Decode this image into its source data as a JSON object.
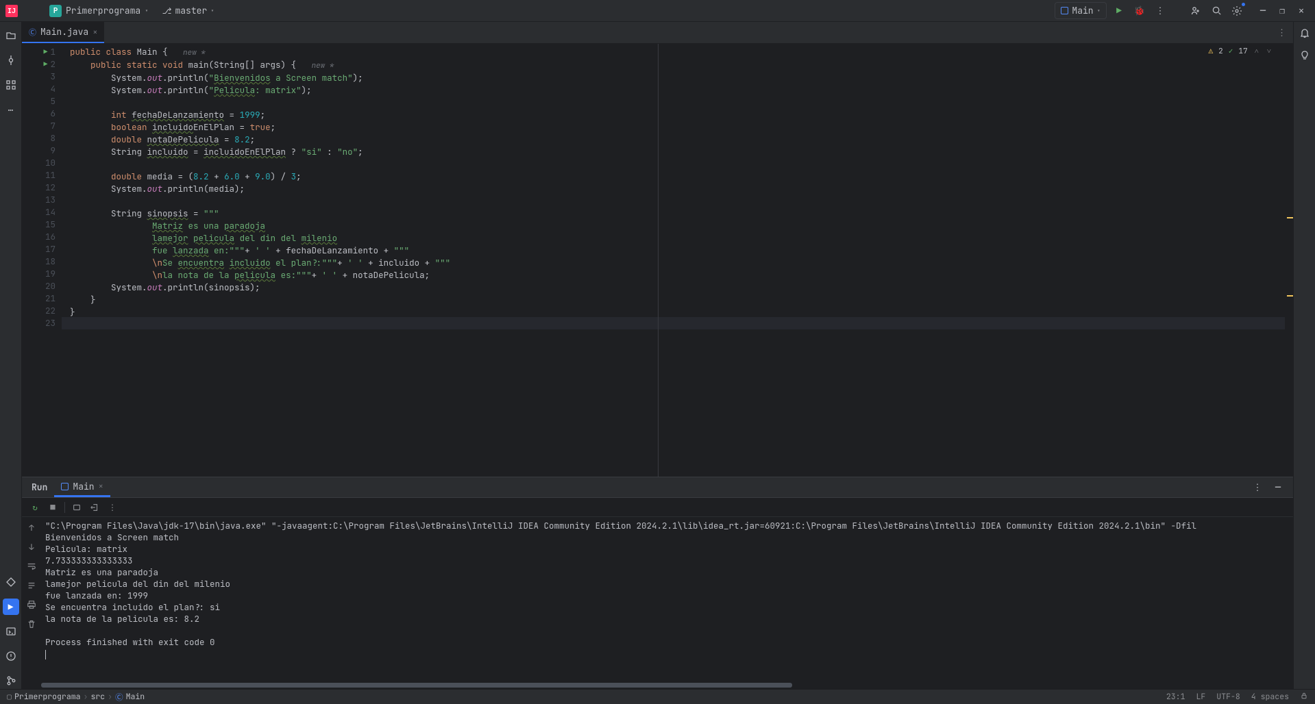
{
  "titlebar": {
    "project_name": "Primerprograma",
    "branch": "master",
    "run_config": "Main"
  },
  "tabs": {
    "file_name": "Main.java"
  },
  "inspections": {
    "warnings": "2",
    "typos": "17"
  },
  "code_lines": [
    {
      "n": 1,
      "run": true,
      "tokens": [
        {
          "t": "public class ",
          "c": "kw"
        },
        {
          "t": "Main {   "
        },
        {
          "t": "new *",
          "c": "hint"
        }
      ]
    },
    {
      "n": 2,
      "run": true,
      "tokens": [
        {
          "t": "    "
        },
        {
          "t": "public static void ",
          "c": "kw"
        },
        {
          "t": "main"
        },
        {
          "t": "(String[] args) {   "
        },
        {
          "t": "new *",
          "c": "hint"
        }
      ]
    },
    {
      "n": 3,
      "tokens": [
        {
          "t": "        System."
        },
        {
          "t": "out",
          "c": "field"
        },
        {
          "t": ".println("
        },
        {
          "t": "\"",
          "c": "str"
        },
        {
          "t": "Bienvenidos",
          "c": "str typo"
        },
        {
          "t": " a Screen match\"",
          "c": "str"
        },
        {
          "t": ");"
        }
      ]
    },
    {
      "n": 4,
      "tokens": [
        {
          "t": "        System."
        },
        {
          "t": "out",
          "c": "field"
        },
        {
          "t": ".println("
        },
        {
          "t": "\"",
          "c": "str"
        },
        {
          "t": "Pelicula",
          "c": "str typo"
        },
        {
          "t": ": matrix\"",
          "c": "str"
        },
        {
          "t": ");"
        }
      ]
    },
    {
      "n": 5,
      "tokens": [
        {
          "t": " "
        }
      ]
    },
    {
      "n": 6,
      "tokens": [
        {
          "t": "        "
        },
        {
          "t": "int ",
          "c": "kw"
        },
        {
          "t": "fechaDeLanzamiento",
          "c": "typo"
        },
        {
          "t": " = "
        },
        {
          "t": "1999",
          "c": "num"
        },
        {
          "t": ";"
        }
      ]
    },
    {
      "n": 7,
      "tokens": [
        {
          "t": "        "
        },
        {
          "t": "boolean ",
          "c": "kw"
        },
        {
          "t": "incluido",
          "c": "typo"
        },
        {
          "t": "EnElPlan = "
        },
        {
          "t": "true",
          "c": "kw"
        },
        {
          "t": ";"
        }
      ]
    },
    {
      "n": 8,
      "tokens": [
        {
          "t": "        "
        },
        {
          "t": "double ",
          "c": "kw"
        },
        {
          "t": "notaDePelicula",
          "c": "typo"
        },
        {
          "t": " = "
        },
        {
          "t": "8.2",
          "c": "num"
        },
        {
          "t": ";"
        }
      ]
    },
    {
      "n": 9,
      "tokens": [
        {
          "t": "        String "
        },
        {
          "t": "incluido",
          "c": "typo"
        },
        {
          "t": " = "
        },
        {
          "t": "incluidoEnElPlan",
          "c": "typo"
        },
        {
          "t": " ? "
        },
        {
          "t": "\"si\"",
          "c": "str"
        },
        {
          "t": " : "
        },
        {
          "t": "\"no\"",
          "c": "str"
        },
        {
          "t": ";"
        }
      ]
    },
    {
      "n": 10,
      "tokens": [
        {
          "t": " "
        }
      ]
    },
    {
      "n": 11,
      "tokens": [
        {
          "t": "        "
        },
        {
          "t": "double ",
          "c": "kw"
        },
        {
          "t": "media = ("
        },
        {
          "t": "8.2",
          "c": "num"
        },
        {
          "t": " + "
        },
        {
          "t": "6.0",
          "c": "num"
        },
        {
          "t": " + "
        },
        {
          "t": "9.0",
          "c": "num"
        },
        {
          "t": ") / "
        },
        {
          "t": "3",
          "c": "num"
        },
        {
          "t": ";"
        }
      ]
    },
    {
      "n": 12,
      "tokens": [
        {
          "t": "        System."
        },
        {
          "t": "out",
          "c": "field"
        },
        {
          "t": ".println(media);"
        }
      ]
    },
    {
      "n": 13,
      "tokens": [
        {
          "t": " "
        }
      ]
    },
    {
      "n": 14,
      "tokens": [
        {
          "t": "        String "
        },
        {
          "t": "sinopsis",
          "c": "typo"
        },
        {
          "t": " = "
        },
        {
          "t": "\"\"\"",
          "c": "str"
        }
      ]
    },
    {
      "n": 15,
      "tokens": [
        {
          "t": "                "
        },
        {
          "t": "Matriz",
          "c": "str typo"
        },
        {
          "t": " es una ",
          "c": "str"
        },
        {
          "t": "paradoja",
          "c": "str typo"
        }
      ]
    },
    {
      "n": 16,
      "tokens": [
        {
          "t": "                "
        },
        {
          "t": "lamejor",
          "c": "str typo"
        },
        {
          "t": " ",
          "c": "str"
        },
        {
          "t": "pelicula",
          "c": "str typo"
        },
        {
          "t": " del din del ",
          "c": "str"
        },
        {
          "t": "milenio",
          "c": "str typo"
        },
        {
          "t": " ",
          "c": "str"
        }
      ]
    },
    {
      "n": 17,
      "tokens": [
        {
          "t": "                "
        },
        {
          "t": "fue ",
          "c": "str"
        },
        {
          "t": "lanzada",
          "c": "str typo"
        },
        {
          "t": " en:\"\"\"",
          "c": "str"
        },
        {
          "t": "+ "
        },
        {
          "t": "' '",
          "c": "str"
        },
        {
          "t": " + fechaDeLanzamiento + "
        },
        {
          "t": "\"\"\"",
          "c": "str"
        }
      ]
    },
    {
      "n": 18,
      "tokens": [
        {
          "t": "                "
        },
        {
          "t": "\\n",
          "c": "kw"
        },
        {
          "t": "Se ",
          "c": "str"
        },
        {
          "t": "encuentra",
          "c": "str typo"
        },
        {
          "t": " ",
          "c": "str"
        },
        {
          "t": "incluido",
          "c": "str typo"
        },
        {
          "t": " el plan?:\"\"\"",
          "c": "str"
        },
        {
          "t": "+ "
        },
        {
          "t": "' '",
          "c": "str"
        },
        {
          "t": " + incluido + "
        },
        {
          "t": "\"\"\"",
          "c": "str"
        }
      ]
    },
    {
      "n": 19,
      "tokens": [
        {
          "t": "                "
        },
        {
          "t": "\\n",
          "c": "kw"
        },
        {
          "t": "la nota de la ",
          "c": "str"
        },
        {
          "t": "pelicula",
          "c": "str typo"
        },
        {
          "t": " es:\"\"\"",
          "c": "str"
        },
        {
          "t": "+ "
        },
        {
          "t": "' '",
          "c": "str"
        },
        {
          "t": " + notaDePelicula;"
        }
      ]
    },
    {
      "n": 20,
      "tokens": [
        {
          "t": "        System."
        },
        {
          "t": "out",
          "c": "field"
        },
        {
          "t": ".println(sinopsis);"
        }
      ]
    },
    {
      "n": 21,
      "tokens": [
        {
          "t": "    }"
        }
      ]
    },
    {
      "n": 22,
      "tokens": [
        {
          "t": "}"
        }
      ]
    },
    {
      "n": 23,
      "tokens": [
        {
          "t": ""
        }
      ],
      "cursor": true
    }
  ],
  "run_panel": {
    "title": "Run",
    "tab_name": "Main"
  },
  "console_output": [
    "\"C:\\Program Files\\Java\\jdk-17\\bin\\java.exe\" \"-javaagent:C:\\Program Files\\JetBrains\\IntelliJ IDEA Community Edition 2024.2.1\\lib\\idea_rt.jar=60921:C:\\Program Files\\JetBrains\\IntelliJ IDEA Community Edition 2024.2.1\\bin\" -Dfil",
    "Bienvenidos a Screen match",
    "Pelicula: matrix",
    "7.733333333333333",
    "Matriz es una paradoja",
    "lamejor pelicula del din del milenio",
    "fue lanzada en: 1999",
    "Se encuentra incluido el plan?: si",
    "la nota de la pelicula es: 8.2",
    "",
    "Process finished with exit code 0"
  ],
  "breadcrumb": {
    "project": "Primerprograma",
    "folder": "src",
    "file": "Main"
  },
  "status": {
    "position": "23:1",
    "line_sep": "LF",
    "encoding": "UTF-8",
    "indent": "4 spaces"
  }
}
